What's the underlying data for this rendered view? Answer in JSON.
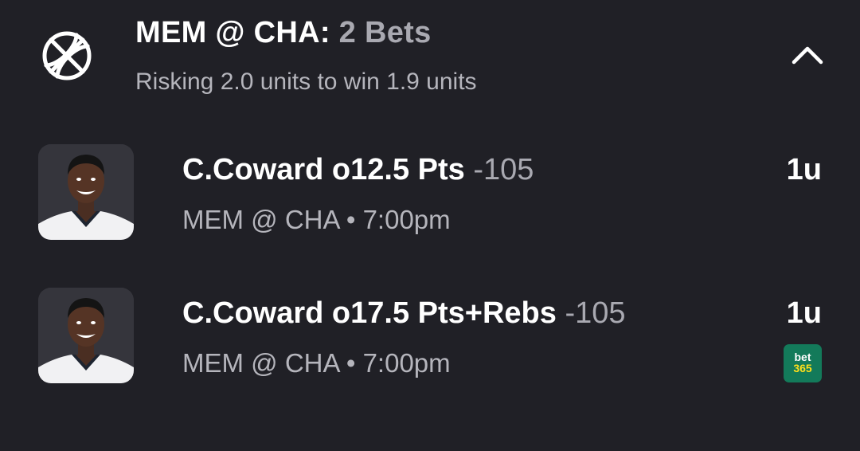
{
  "header": {
    "matchup": "MEM @ CHA:",
    "bet_count": "2 Bets",
    "subtitle": "Risking 2.0 units to win 1.9 units",
    "sport_icon": "basketball-icon",
    "collapse_icon": "chevron-up-icon"
  },
  "bets": [
    {
      "selection": "C.Coward o12.5 Pts",
      "odds": "-105",
      "meta": "MEM @ CHA • 7:00pm",
      "units": "1u",
      "avatar": "player-headshot"
    },
    {
      "selection": "C.Coward o17.5 Pts+Rebs",
      "odds": "-105",
      "meta": "MEM @ CHA • 7:00pm",
      "units": "1u",
      "avatar": "player-headshot",
      "book": {
        "line1": "bet",
        "line2": "365",
        "color": "#137a5a",
        "accent": "#ffdf1b"
      }
    }
  ],
  "colors": {
    "background": "#202026",
    "primary_text": "#ffffff",
    "secondary_text": "#b5b5bc",
    "odds_text": "#a9a9b1"
  }
}
